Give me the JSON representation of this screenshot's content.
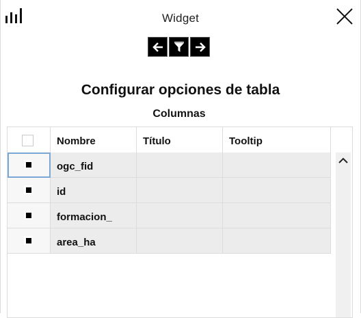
{
  "window": {
    "title": "Widget",
    "menu_icon": "bar-chart-icon",
    "close_icon": "close-icon"
  },
  "toolbar": {
    "buttons": [
      {
        "icon": "arrow-left-icon"
      },
      {
        "icon": "filter-icon"
      },
      {
        "icon": "arrow-right-icon"
      }
    ]
  },
  "main": {
    "heading": "Configurar opciones de tabla",
    "subheading": "Columnas"
  },
  "table": {
    "columns": [
      "Nombre",
      "Título",
      "Tooltip"
    ],
    "rows": [
      {
        "nombre": "ogc_fid",
        "titulo": "",
        "tooltip": "",
        "checked": true
      },
      {
        "nombre": "id",
        "titulo": "",
        "tooltip": "",
        "checked": true
      },
      {
        "nombre": "formacion_",
        "titulo": "",
        "tooltip": "",
        "checked": true
      },
      {
        "nombre": "area_ha",
        "titulo": "",
        "tooltip": "",
        "checked": true
      }
    ],
    "header_checked": false
  },
  "colors": {
    "accent_focus": "#7aa7d6",
    "row_background": "#ececec",
    "border": "#dcdcdc"
  }
}
